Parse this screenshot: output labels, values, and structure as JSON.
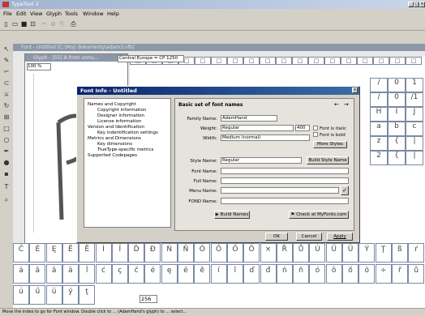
{
  "app": {
    "title": "TypeTool 2"
  },
  "menu": [
    "File",
    "Edit",
    "View",
    "Glyph",
    "Tools",
    "Window",
    "Help"
  ],
  "font_window": {
    "title": "Font - Untitled [C:\\Moji dokumenty\\adam3.vfb]"
  },
  "glyph_window": {
    "title": "Glyph - [55] A from unnu..."
  },
  "zoom": "100 %",
  "encoding": "Central Europe = CP 1250",
  "right_glyphs": [
    [
      "/",
      "0",
      "1"
    ],
    [
      "/",
      "0",
      "/1"
    ],
    [
      "H",
      "I",
      "J"
    ],
    [
      "a",
      "b",
      "c"
    ],
    [
      "z",
      "{",
      "|"
    ],
    [
      "2",
      "{",
      "|"
    ]
  ],
  "top_row_chars": [
    "",
    "",
    "",
    "",
    "",
    "",
    "",
    "",
    "",
    "",
    "",
    "",
    "",
    "",
    "",
    "",
    "",
    ""
  ],
  "row1_chars": [
    "Č",
    "É",
    "Ę",
    "Ë",
    "Ě",
    "Í",
    "Î",
    "Ď",
    "Đ",
    "Ń",
    "Ň",
    "Ó",
    "Ô",
    "Ő",
    "Ö",
    "×",
    "Ř",
    "Ů",
    "Ú",
    "Ű",
    "Ü",
    "Ý",
    "Ţ",
    "ß",
    "ŕ"
  ],
  "row2_chars": [
    "á",
    "â",
    "ă",
    "ä",
    "ĺ",
    "ć",
    "ç",
    "č",
    "é",
    "ę",
    "ë",
    "ě",
    "í",
    "î",
    "ď",
    "đ",
    "ń",
    "ň",
    "ó",
    "ô",
    "ő",
    "ö",
    "÷",
    "ř",
    "ů"
  ],
  "row3_chars": [
    "ú",
    "ű",
    "ü",
    "ý",
    "ţ"
  ],
  "glyph_count": "256",
  "dialog": {
    "title": "Font Info - Untitled",
    "tree": [
      {
        "label": "Names and Copyright",
        "level": 0
      },
      {
        "label": "Copyright information",
        "level": 1
      },
      {
        "label": "Designer information",
        "level": 1
      },
      {
        "label": "License information",
        "level": 1
      },
      {
        "label": "Version and Identification",
        "level": 0
      },
      {
        "label": "Key indentification settings",
        "level": 1
      },
      {
        "label": "Metrics and Dimensions",
        "level": 0
      },
      {
        "label": "Key dimensions",
        "level": 1
      },
      {
        "label": "TrueType-specific metrics",
        "level": 1
      },
      {
        "label": "Supported Codepages",
        "level": 0
      }
    ],
    "section_title": "Basic set of font names",
    "family_name_label": "Family Name:",
    "family_name_value": "AdamHand",
    "weight_label": "Weight:",
    "weight_value": "Regular",
    "weight_num": "400",
    "font_is_italic": "Font is italic",
    "font_is_bold": "Font is bold",
    "width_label": "Width:",
    "width_value": "Medium (normal)",
    "more_styles": "More Styles",
    "style_name_label": "Style Name:",
    "style_name_value": "Regular",
    "build_style_name": "Build Style Name",
    "font_name_label": "Font Name:",
    "full_name_label": "Full Name:",
    "menu_name_label": "Menu Name:",
    "fond_name_label": "FOND Name:",
    "build_names": "Build Names",
    "check_myfonts": "Check at MyFonts.com",
    "ok": "OK",
    "cancel": "Cancel",
    "apply": "Apply"
  },
  "status": "Move the index to go for Font window. Double click to ... (AdamHand's glyph) to ... select..."
}
